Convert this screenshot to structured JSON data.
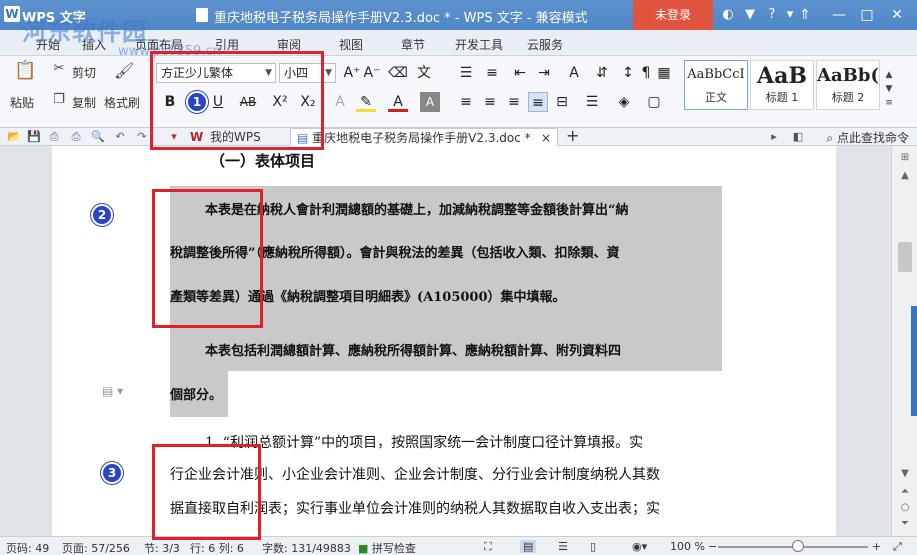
{
  "titlebar": {
    "app_name": "WPS 文字",
    "doc_title": "重庆地税电子税务局操作手册V2.3.doc * - WPS 文字 - 兼容模式",
    "login_label": "未登录"
  },
  "menu": [
    "开始",
    "插入",
    "页面布局",
    "引用",
    "审阅",
    "视图",
    "章节",
    "开发工具",
    "云服务"
  ],
  "ribbon": {
    "cut": "剪切",
    "paste": "粘贴",
    "copy": "复制",
    "format_painter": "格式刷",
    "font_name": "方正少儿繁体",
    "font_size": "小四",
    "styles": [
      {
        "sample": "AaBbCcI",
        "name": "正文"
      },
      {
        "sample": "AaB",
        "name": "标题 1"
      },
      {
        "sample": "AaBb(",
        "name": "标题 2"
      }
    ]
  },
  "tabs": {
    "my_wps": "我的WPS",
    "doc_tab": "重庆地税电子税务局操作手册V2.3.doc *",
    "close": "×",
    "add": "+",
    "search_cmd": "点此查找命令"
  },
  "document": {
    "heading": "（一）表体项目",
    "lines": [
      "本表是在納稅人會計利潤總額的基礎上，加減納稅調整等金額後計算出“納",
      "稅調整後所得”（應納稅所得額）。會計與稅法的差異（包括收入類、扣除類、資",
      "產類等差異）通過《納稅調整項目明細表》(A105000）集中填報。",
      "本表包括利潤總額計算、應納稅所得額計算、應納稅額計算、附列資料四",
      "個部分。",
      "1. “利润总额计算”中的项目，按照国家统一会计制度口径计算填报。实",
      "行企业会计准则、小企业会计准则、企业会计制度、分行业会计制度纳税人其数",
      "据直接取自利润表；实行事业单位会计准则的纳税人其数据取自收入支出表；实"
    ]
  },
  "statusbar": {
    "page_num": "页码: 49",
    "page": "页面: 57/256",
    "section": "节: 3/3",
    "row_col": "行: 6  列: 6",
    "word_count": "字数: 131/49883",
    "spell": "拼写检查",
    "zoom": "100 %"
  },
  "markers": [
    "1",
    "2",
    "3"
  ],
  "watermark": {
    "text": "河东软件园",
    "url": "www.pc0359.cn"
  },
  "colors": {
    "title_bar": "#4f86c6",
    "login": "#e2533d",
    "annotation": "#e0202a",
    "marker": "#2a44c7",
    "highlight": "#c9c9c9"
  }
}
